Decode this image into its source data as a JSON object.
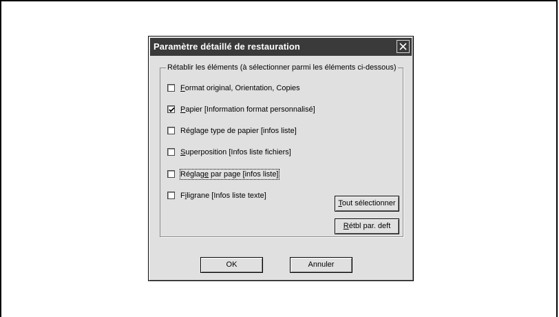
{
  "dialog": {
    "title": "Paramètre détaillé de restauration",
    "group_label": "Rétablir les éléments (à sélectionner parmi les éléments ci-dessous)",
    "items": [
      {
        "mnemonic": "F",
        "rest": "ormat original, Orientation, Copies",
        "checked": false
      },
      {
        "mnemonic": "P",
        "rest": "apier [Information format personnalisé]",
        "checked": true
      },
      {
        "pre": "Ré",
        "mnemonic": "g",
        "rest": "lage type de papier [infos liste]",
        "checked": false
      },
      {
        "mnemonic": "S",
        "rest": "uperposition [Infos liste fichiers]",
        "checked": false
      },
      {
        "pre": "Réglag",
        "mnemonic": "e",
        "rest": " par page [infos liste]",
        "checked": false,
        "focused": true
      },
      {
        "pre": "F",
        "mnemonic": "i",
        "rest": "ligrane [Infos liste texte]",
        "checked": false
      }
    ],
    "select_all": {
      "mnemonic": "T",
      "rest": "out sélectionner"
    },
    "restore_default": {
      "mnemonic": "R",
      "rest": "étbl par. deft"
    },
    "ok_label": "OK",
    "cancel_label": "Annuler",
    "close_icon": "close-icon",
    "check_icon": "checkmark-icon"
  }
}
